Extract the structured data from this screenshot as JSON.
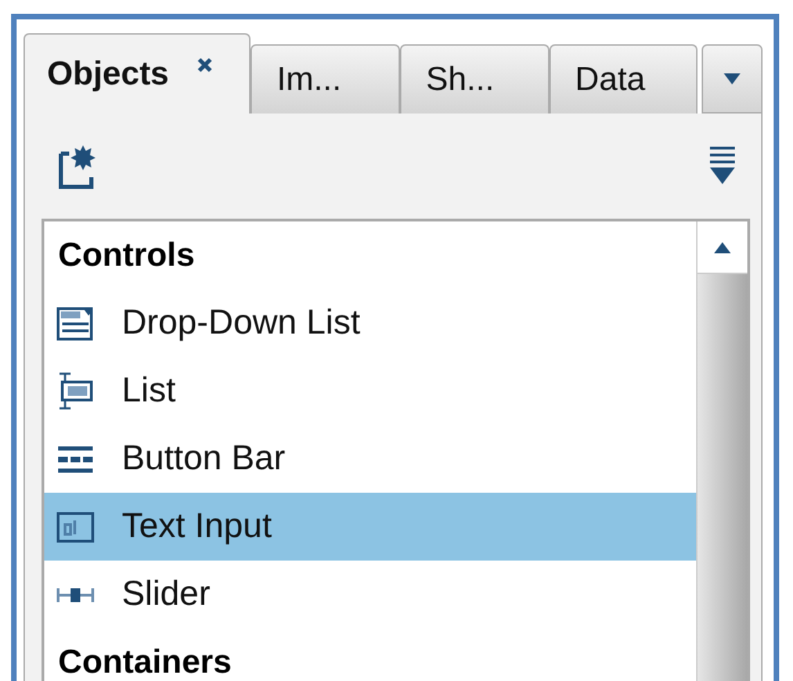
{
  "tabs": [
    {
      "label": "Objects",
      "selected": true,
      "closable": true
    },
    {
      "label": "Im...",
      "selected": false,
      "closable": false
    },
    {
      "label": "Sh...",
      "selected": false,
      "closable": false
    },
    {
      "label": "Data",
      "selected": false,
      "closable": false
    }
  ],
  "groups": [
    {
      "heading": "Controls",
      "items": [
        {
          "label": "Drop-Down List",
          "kind": "dropdown",
          "selected": false
        },
        {
          "label": "List",
          "kind": "list",
          "selected": false
        },
        {
          "label": "Button Bar",
          "kind": "buttonbar",
          "selected": false
        },
        {
          "label": "Text Input",
          "kind": "textinput",
          "selected": true
        },
        {
          "label": "Slider",
          "kind": "slider",
          "selected": false
        }
      ]
    },
    {
      "heading": "Containers"
    }
  ]
}
